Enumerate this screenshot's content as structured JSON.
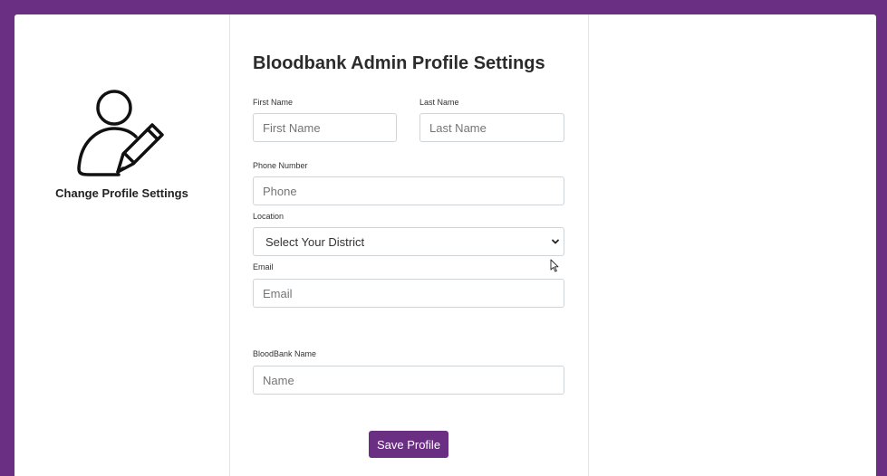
{
  "sidebar": {
    "caption": "Change Profile Settings",
    "icon": "user-edit-icon"
  },
  "form": {
    "title": "Bloodbank Admin Profile Settings",
    "first_name": {
      "label": "First Name",
      "placeholder": "First Name",
      "value": ""
    },
    "last_name": {
      "label": "Last Name",
      "placeholder": "Last Name",
      "value": ""
    },
    "phone": {
      "label": "Phone Number",
      "placeholder": "Phone",
      "value": ""
    },
    "location": {
      "label": "Location",
      "selected": "Select Your District"
    },
    "email": {
      "label": "Email",
      "placeholder": "Email",
      "value": ""
    },
    "bloodbank_name": {
      "label": "BloodBank Name",
      "placeholder": "Name",
      "value": ""
    },
    "save_label": "Save Profile"
  },
  "colors": {
    "background": "#6a2f82",
    "accent": "#6a2f82",
    "card": "#ffffff"
  }
}
